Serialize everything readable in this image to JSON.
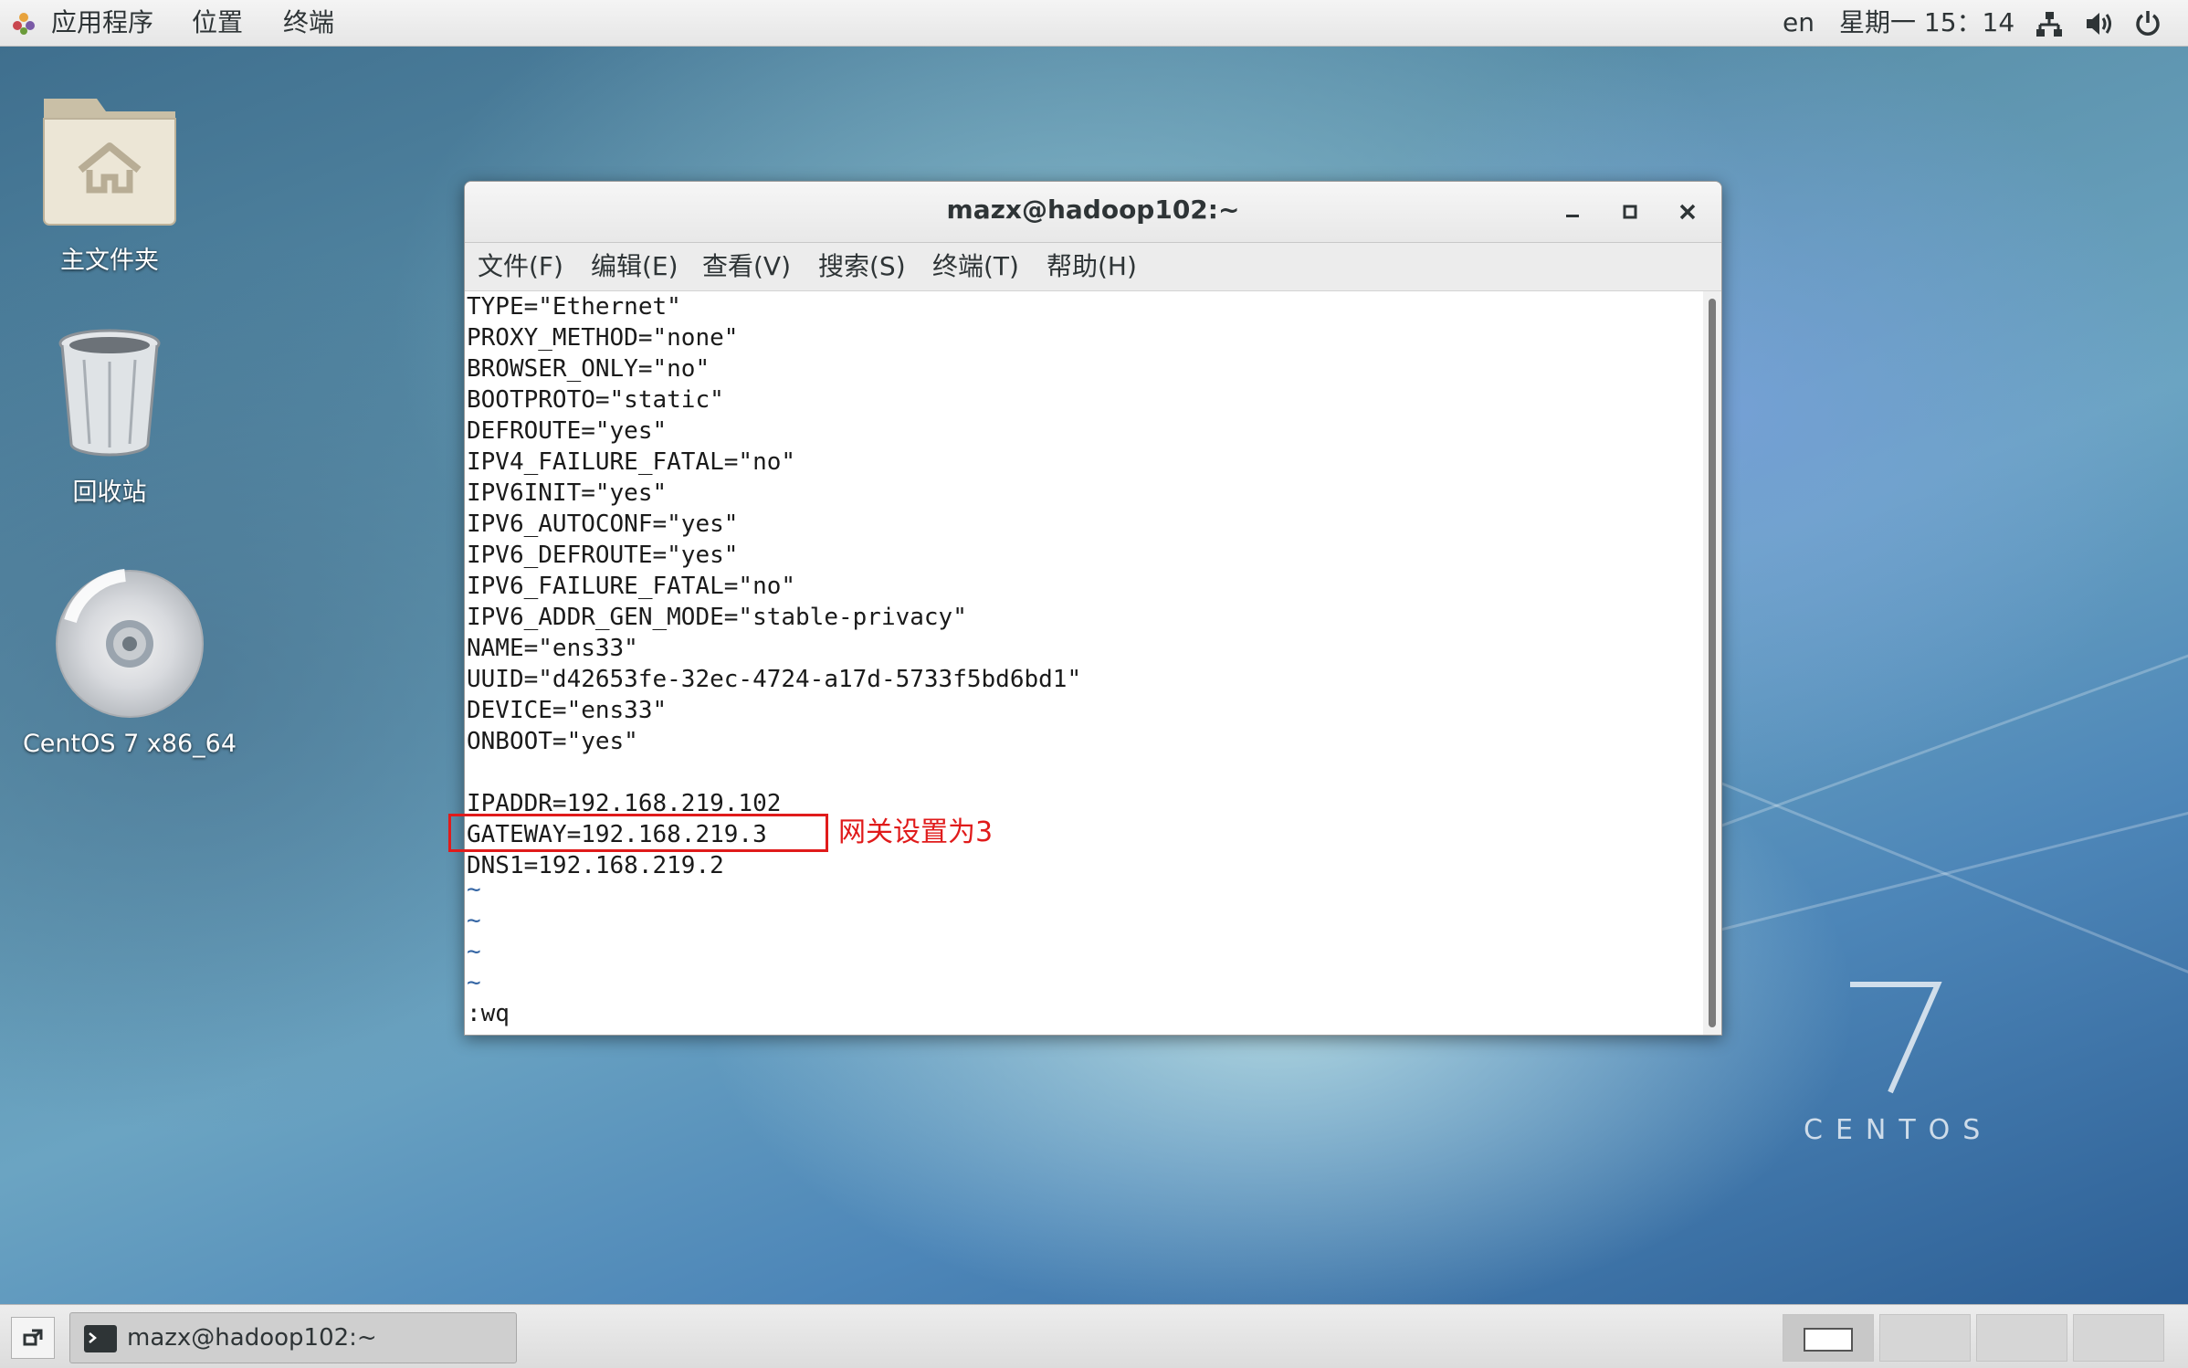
{
  "topbar": {
    "applications": "应用程序",
    "places": "位置",
    "terminal": "终端",
    "language": "en",
    "clock": "星期一 15：14"
  },
  "desktop": {
    "icons": [
      {
        "label": "主文件夹",
        "icon": "home-folder-icon"
      },
      {
        "label": "回收站",
        "icon": "trash-icon"
      },
      {
        "label": "CentOS 7 x86_64",
        "icon": "disc-icon"
      }
    ],
    "brand_number": "7",
    "brand_word": "CENTOS"
  },
  "window": {
    "title": "mazx@hadoop102:~",
    "menu": [
      "文件(F)",
      "编辑(E)",
      "查看(V)",
      "搜索(S)",
      "终端(T)",
      "帮助(H)"
    ],
    "lines": [
      "TYPE=\"Ethernet\"",
      "PROXY_METHOD=\"none\"",
      "BROWSER_ONLY=\"no\"",
      "BOOTPROTO=\"static\"",
      "DEFROUTE=\"yes\"",
      "IPV4_FAILURE_FATAL=\"no\"",
      "IPV6INIT=\"yes\"",
      "IPV6_AUTOCONF=\"yes\"",
      "IPV6_DEFROUTE=\"yes\"",
      "IPV6_FAILURE_FATAL=\"no\"",
      "IPV6_ADDR_GEN_MODE=\"stable-privacy\"",
      "NAME=\"ens33\"",
      "UUID=\"d42653fe-32ec-4724-a17d-5733f5bd6bd1\"",
      "DEVICE=\"ens33\"",
      "ONBOOT=\"yes\"",
      "",
      "IPADDR=192.168.219.102",
      "GATEWAY=192.168.219.3",
      "DNS1=192.168.219.2"
    ],
    "tildes": [
      "~",
      "~",
      "~",
      "~"
    ],
    "command": ":wq"
  },
  "annotation": {
    "text": "网关设置为3",
    "color": "#e01b1b"
  },
  "taskbar": {
    "task_label": "mazx@hadoop102:~"
  }
}
